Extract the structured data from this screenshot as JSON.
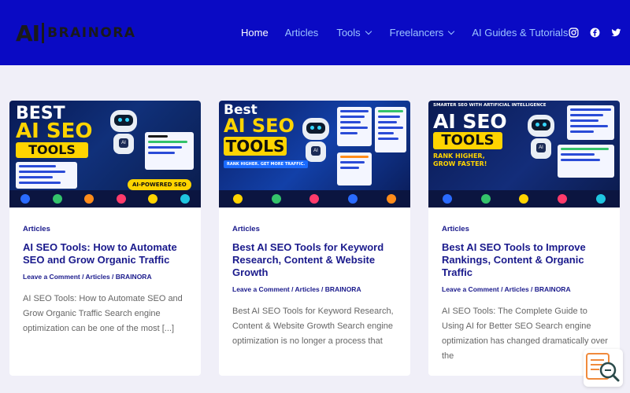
{
  "brand": {
    "logo_ai": "AI",
    "logo_text": "BRAINORA"
  },
  "nav": {
    "items": [
      {
        "label": "Home"
      },
      {
        "label": "Articles"
      },
      {
        "label": "Tools"
      },
      {
        "label": "Freelancers"
      },
      {
        "label": "AI Guides & Tutorials"
      }
    ]
  },
  "social": [
    "instagram-icon",
    "facebook-icon",
    "twitter-icon"
  ],
  "colors": {
    "header": "#0a0ac4",
    "accent": "#1a1a8c",
    "nav_link": "#9cc4ff",
    "background": "#f0eff8"
  },
  "posts": [
    {
      "category": "Articles",
      "title": "AI SEO Tools: How to Automate SEO and Grow Organic Traffic",
      "meta": "Leave a Comment / Articles / BRAINORA",
      "excerpt": "AI SEO Tools: How to Automate SEO and Grow Organic Traffic Search engine optimization can be one of the most [...]",
      "thumb": {
        "line1": "BEST",
        "line2": "AI SEO",
        "line3": "TOOLS",
        "badge": "AI-POWERED SEO"
      }
    },
    {
      "category": "Articles",
      "title": "Best AI SEO Tools for Keyword Research, Content & Website Growth",
      "meta": "Leave a Comment / Articles / BRAINORA",
      "excerpt": "Best AI SEO Tools for Keyword Research, Content & Website Growth Search engine optimization is no longer a process that",
      "thumb": {
        "line1": "Best",
        "line2": "AI SEO",
        "line3": "TOOLS",
        "sub": "RANK HIGHER. GET MORE TRAFFIC."
      }
    },
    {
      "category": "Articles",
      "title": "Best AI SEO Tools to Improve Rankings, Content & Organic Traffic",
      "meta": "Leave a Comment / Articles / BRAINORA",
      "excerpt": "AI SEO Tools: The Complete Guide to Using AI for Better SEO Search engine optimization has changed dramatically over the",
      "thumb": {
        "line1": "SMARTER SEO WITH ARTIFICIAL INTELLIGENCE",
        "line2": "AI SEO",
        "line3": "TOOLS",
        "sub": "RANK HIGHER, GROW FASTER!"
      }
    }
  ]
}
